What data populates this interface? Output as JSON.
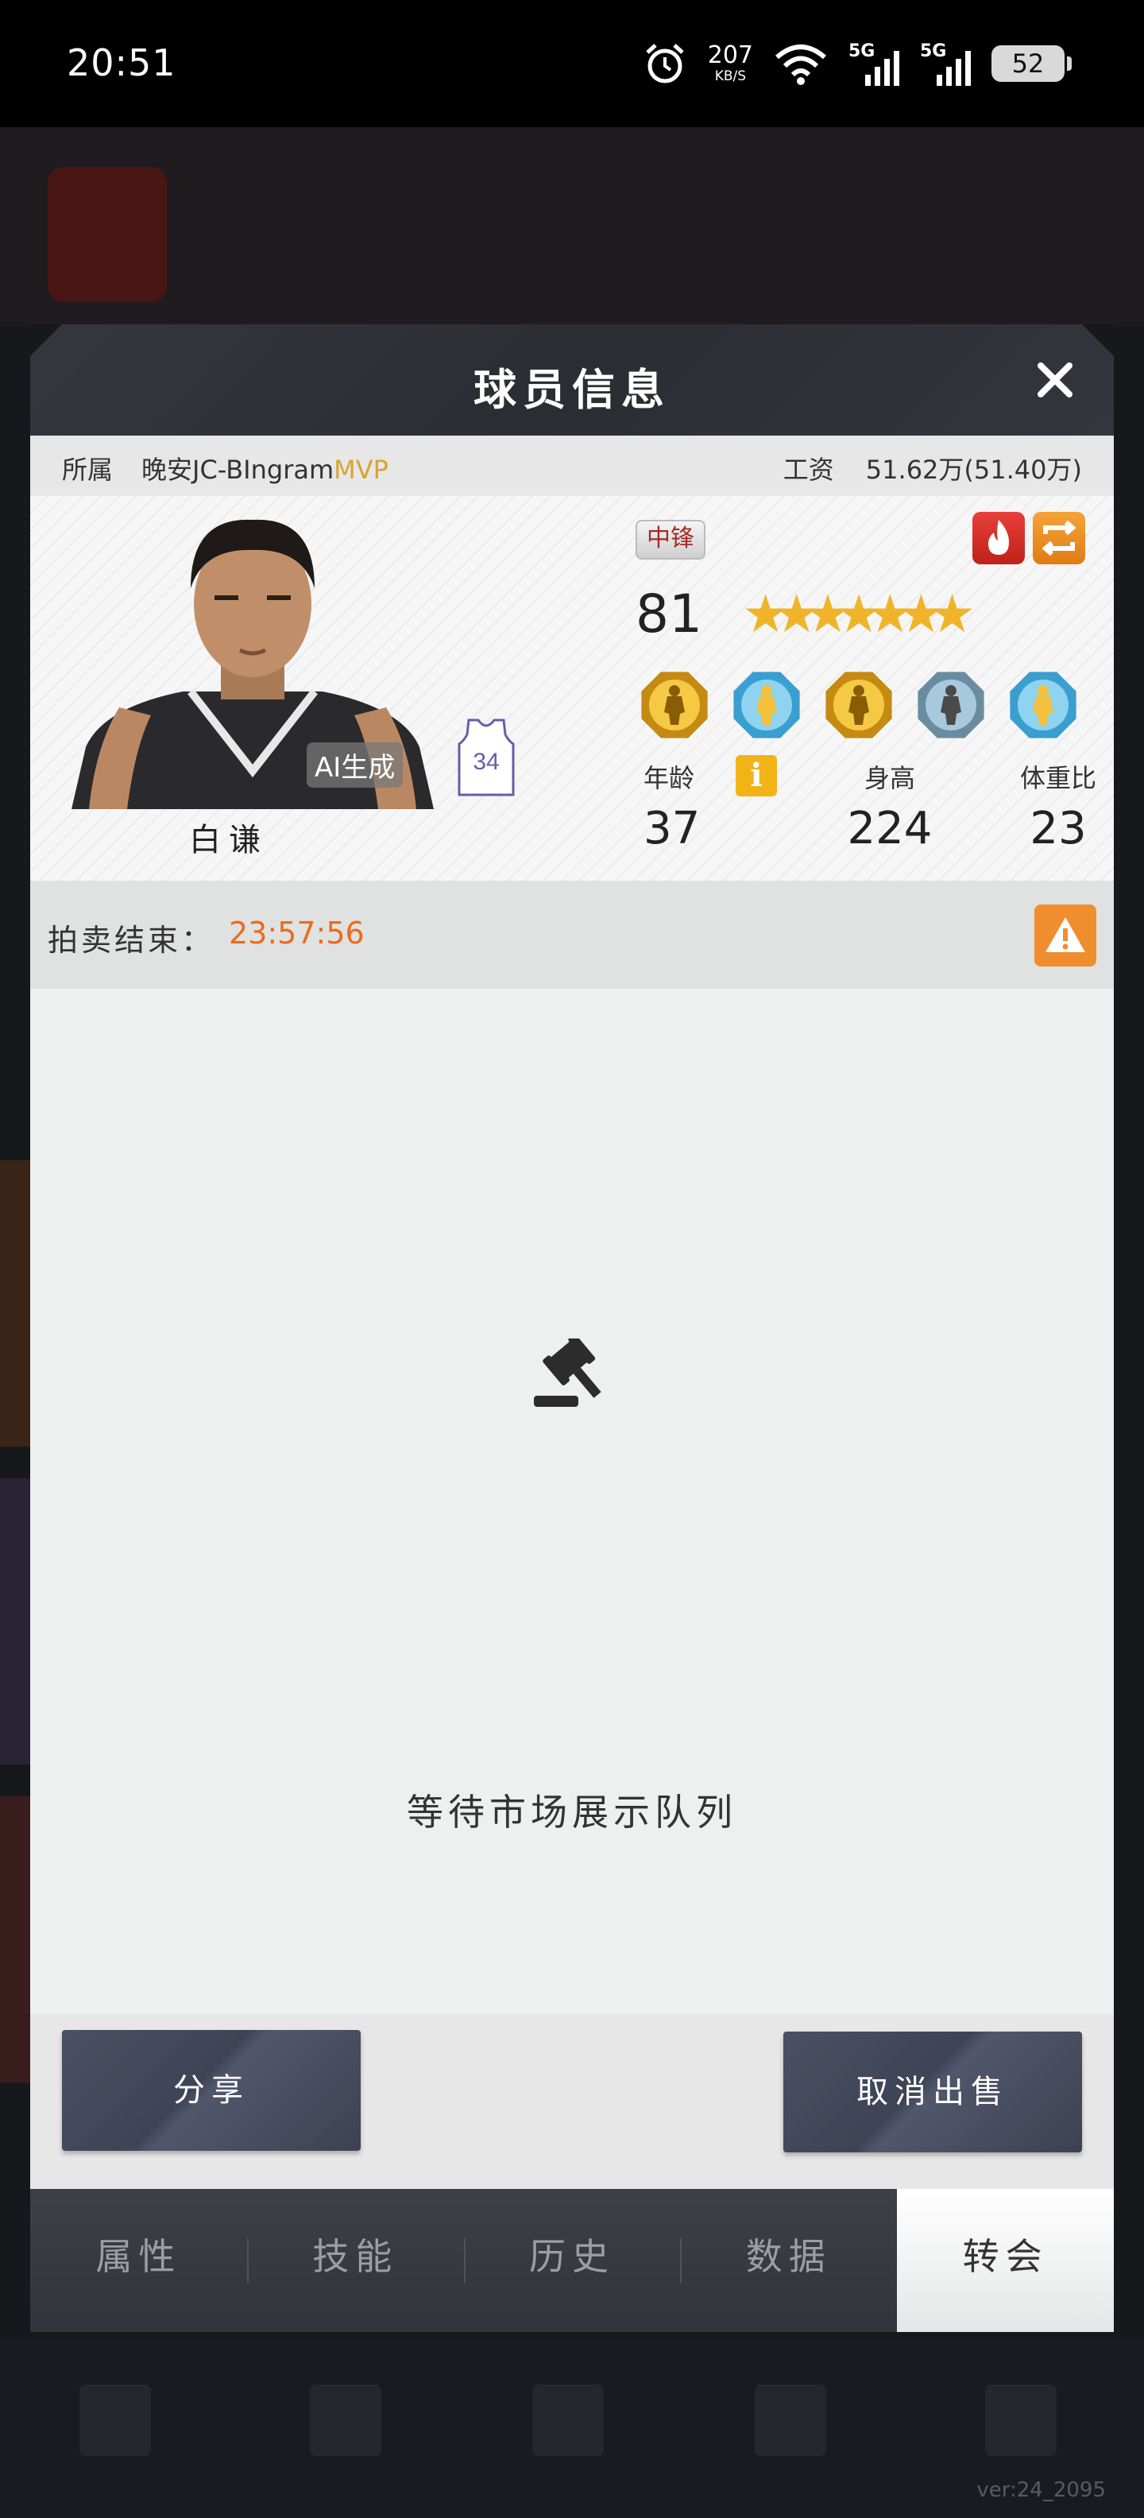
{
  "status_bar": {
    "time": "20:51",
    "net_speed": "207",
    "net_unit": "KB/S",
    "signal_1": "5G",
    "signal_2": "5G",
    "battery": "52"
  },
  "dialog": {
    "title": "球员信息",
    "owner_label": "所属",
    "owner_team": "晚安JC-BIngram",
    "owner_suffix": "MVP",
    "salary_label": "工资",
    "salary_value": "51.62万(51.40万)"
  },
  "player": {
    "name": "白谦",
    "position": "中锋",
    "rating": "81",
    "stars_total": 7,
    "jersey_number": "34",
    "ai_badge": "AI生成",
    "stats": {
      "age_label": "年龄",
      "age": "37",
      "height_label": "身高",
      "height": "224",
      "weight_ratio_label": "体重比",
      "weight_ratio": "23"
    },
    "skill_badges": [
      "gold-dribble-icon",
      "blue-shooter-icon",
      "gold-lightning-icon",
      "silver-defender-icon",
      "blue-dunker-icon"
    ]
  },
  "auction": {
    "label": "拍卖结束：",
    "remaining": "23:57:56"
  },
  "main": {
    "waiting_text": "等待市场展示队列"
  },
  "actions": {
    "share": "分享",
    "cancel_sale": "取消出售"
  },
  "tabs": [
    {
      "label": "属性",
      "active": false
    },
    {
      "label": "技能",
      "active": false
    },
    {
      "label": "历史",
      "active": false
    },
    {
      "label": "数据",
      "active": false
    },
    {
      "label": "转会",
      "active": true
    }
  ],
  "background": {
    "version": "ver:24_2095"
  },
  "colors": {
    "accent_orange": "#ee6a1c",
    "mvp_gold": "#d8a530",
    "header_dark": "#2f3238"
  }
}
